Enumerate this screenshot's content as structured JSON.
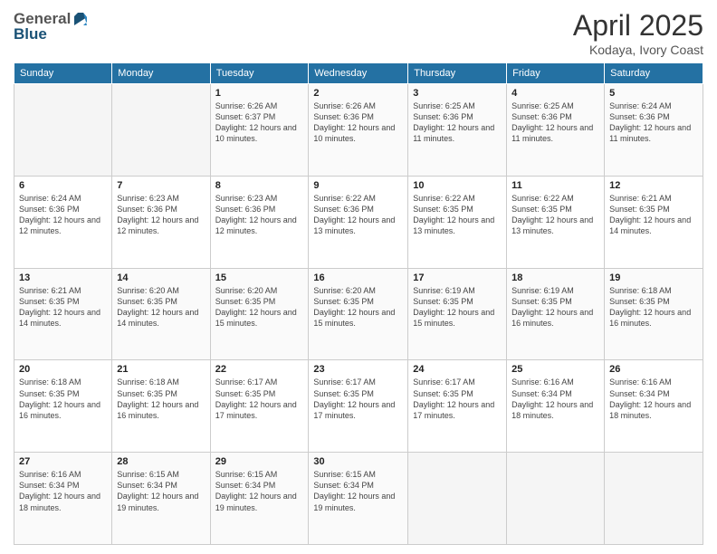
{
  "header": {
    "logo_general": "General",
    "logo_blue": "Blue",
    "title": "April 2025",
    "subtitle": "Kodaya, Ivory Coast"
  },
  "days_of_week": [
    "Sunday",
    "Monday",
    "Tuesday",
    "Wednesday",
    "Thursday",
    "Friday",
    "Saturday"
  ],
  "weeks": [
    [
      {
        "day": "",
        "info": ""
      },
      {
        "day": "",
        "info": ""
      },
      {
        "day": "1",
        "info": "Sunrise: 6:26 AM\nSunset: 6:37 PM\nDaylight: 12 hours and 10 minutes."
      },
      {
        "day": "2",
        "info": "Sunrise: 6:26 AM\nSunset: 6:36 PM\nDaylight: 12 hours and 10 minutes."
      },
      {
        "day": "3",
        "info": "Sunrise: 6:25 AM\nSunset: 6:36 PM\nDaylight: 12 hours and 11 minutes."
      },
      {
        "day": "4",
        "info": "Sunrise: 6:25 AM\nSunset: 6:36 PM\nDaylight: 12 hours and 11 minutes."
      },
      {
        "day": "5",
        "info": "Sunrise: 6:24 AM\nSunset: 6:36 PM\nDaylight: 12 hours and 11 minutes."
      }
    ],
    [
      {
        "day": "6",
        "info": "Sunrise: 6:24 AM\nSunset: 6:36 PM\nDaylight: 12 hours and 12 minutes."
      },
      {
        "day": "7",
        "info": "Sunrise: 6:23 AM\nSunset: 6:36 PM\nDaylight: 12 hours and 12 minutes."
      },
      {
        "day": "8",
        "info": "Sunrise: 6:23 AM\nSunset: 6:36 PM\nDaylight: 12 hours and 12 minutes."
      },
      {
        "day": "9",
        "info": "Sunrise: 6:22 AM\nSunset: 6:36 PM\nDaylight: 12 hours and 13 minutes."
      },
      {
        "day": "10",
        "info": "Sunrise: 6:22 AM\nSunset: 6:35 PM\nDaylight: 12 hours and 13 minutes."
      },
      {
        "day": "11",
        "info": "Sunrise: 6:22 AM\nSunset: 6:35 PM\nDaylight: 12 hours and 13 minutes."
      },
      {
        "day": "12",
        "info": "Sunrise: 6:21 AM\nSunset: 6:35 PM\nDaylight: 12 hours and 14 minutes."
      }
    ],
    [
      {
        "day": "13",
        "info": "Sunrise: 6:21 AM\nSunset: 6:35 PM\nDaylight: 12 hours and 14 minutes."
      },
      {
        "day": "14",
        "info": "Sunrise: 6:20 AM\nSunset: 6:35 PM\nDaylight: 12 hours and 14 minutes."
      },
      {
        "day": "15",
        "info": "Sunrise: 6:20 AM\nSunset: 6:35 PM\nDaylight: 12 hours and 15 minutes."
      },
      {
        "day": "16",
        "info": "Sunrise: 6:20 AM\nSunset: 6:35 PM\nDaylight: 12 hours and 15 minutes."
      },
      {
        "day": "17",
        "info": "Sunrise: 6:19 AM\nSunset: 6:35 PM\nDaylight: 12 hours and 15 minutes."
      },
      {
        "day": "18",
        "info": "Sunrise: 6:19 AM\nSunset: 6:35 PM\nDaylight: 12 hours and 16 minutes."
      },
      {
        "day": "19",
        "info": "Sunrise: 6:18 AM\nSunset: 6:35 PM\nDaylight: 12 hours and 16 minutes."
      }
    ],
    [
      {
        "day": "20",
        "info": "Sunrise: 6:18 AM\nSunset: 6:35 PM\nDaylight: 12 hours and 16 minutes."
      },
      {
        "day": "21",
        "info": "Sunrise: 6:18 AM\nSunset: 6:35 PM\nDaylight: 12 hours and 16 minutes."
      },
      {
        "day": "22",
        "info": "Sunrise: 6:17 AM\nSunset: 6:35 PM\nDaylight: 12 hours and 17 minutes."
      },
      {
        "day": "23",
        "info": "Sunrise: 6:17 AM\nSunset: 6:35 PM\nDaylight: 12 hours and 17 minutes."
      },
      {
        "day": "24",
        "info": "Sunrise: 6:17 AM\nSunset: 6:35 PM\nDaylight: 12 hours and 17 minutes."
      },
      {
        "day": "25",
        "info": "Sunrise: 6:16 AM\nSunset: 6:34 PM\nDaylight: 12 hours and 18 minutes."
      },
      {
        "day": "26",
        "info": "Sunrise: 6:16 AM\nSunset: 6:34 PM\nDaylight: 12 hours and 18 minutes."
      }
    ],
    [
      {
        "day": "27",
        "info": "Sunrise: 6:16 AM\nSunset: 6:34 PM\nDaylight: 12 hours and 18 minutes."
      },
      {
        "day": "28",
        "info": "Sunrise: 6:15 AM\nSunset: 6:34 PM\nDaylight: 12 hours and 19 minutes."
      },
      {
        "day": "29",
        "info": "Sunrise: 6:15 AM\nSunset: 6:34 PM\nDaylight: 12 hours and 19 minutes."
      },
      {
        "day": "30",
        "info": "Sunrise: 6:15 AM\nSunset: 6:34 PM\nDaylight: 12 hours and 19 minutes."
      },
      {
        "day": "",
        "info": ""
      },
      {
        "day": "",
        "info": ""
      },
      {
        "day": "",
        "info": ""
      }
    ]
  ]
}
